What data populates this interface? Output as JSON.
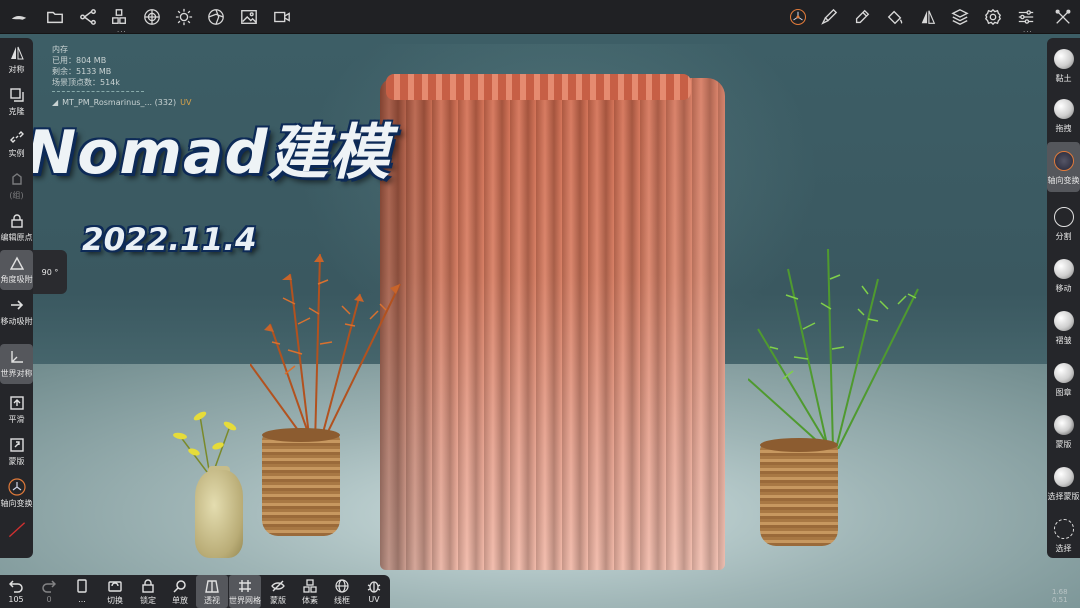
{
  "overlay": {
    "headline": "Nomad建模",
    "date": "2022.11.4"
  },
  "info": {
    "memory_title": "内存",
    "used": "已用：804 MB",
    "remaining": "剩余：5133 MB",
    "scene_vertices": "场景顶点数：514k",
    "mesh_name": "MT_PM_Rosmarinus_... (332)",
    "mesh_uv": "UV"
  },
  "left_toolbar": {
    "symmetry": "对称",
    "clone": "克隆",
    "instance": "实例",
    "hidden": "(组)",
    "edit_origin": "编辑原点",
    "angle_snap": "角度吸附",
    "angle_value": "90 °",
    "move_snap": "移动吸附",
    "world_symmetry": "世界对称",
    "smooth": "平滑",
    "mask": "蒙版",
    "axis_transform": "轴向变换"
  },
  "right_toolbar": {
    "clay": "黏土",
    "drag": "拖拽",
    "axis_transform": "轴向变换",
    "split": "分割",
    "move": "移动",
    "crease": "褶皱",
    "stamp": "图章",
    "mask": "蒙版",
    "select_mask": "选择蒙版",
    "select": "选择"
  },
  "bottom_toolbar": {
    "undo_count": "105",
    "redo_count": "0",
    "more": "...",
    "switch": "切换",
    "lock": "锁定",
    "single": "单放",
    "perspective": "透视",
    "world_grid": "世界网格",
    "mask": "蒙版",
    "voxel": "体素",
    "wireframe": "线框",
    "uv": "UV"
  },
  "version": {
    "line1": "1.68",
    "line2": "0.51"
  },
  "colors": {
    "toolbar_bg": "#25262a",
    "curtain": "#d77a5e",
    "headline_outline": "#0d2a57"
  }
}
